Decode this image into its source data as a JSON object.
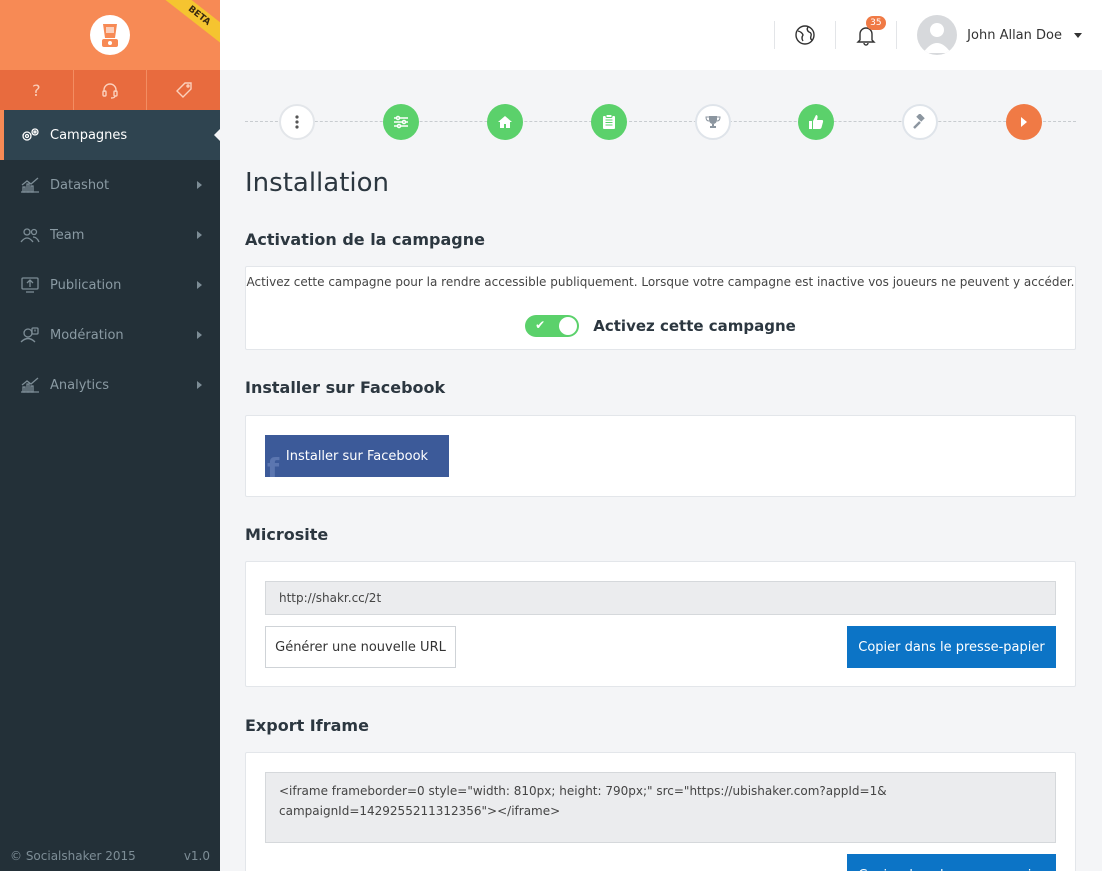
{
  "brand": {
    "beta": "BETA"
  },
  "quick_bar": {
    "help": "?"
  },
  "sidebar": {
    "items": [
      {
        "label": "Campagnes"
      },
      {
        "label": "Datashot"
      },
      {
        "label": "Team"
      },
      {
        "label": "Publication"
      },
      {
        "label": "Modération"
      },
      {
        "label": "Analytics"
      }
    ],
    "footer_copyright": "© Socialshaker 2015",
    "footer_version": "v1.0"
  },
  "topbar": {
    "notifications_count": "35",
    "user_name": "John Allan Doe"
  },
  "page": {
    "title": "Installation"
  },
  "activation": {
    "heading": "Activation de la campagne",
    "description": "Activez cette campagne pour la rendre accessible publiquement. Lorsque votre campagne est inactive vos joueurs ne peuvent y accéder.",
    "toggle_label": "Activez cette campagne"
  },
  "facebook": {
    "heading": "Installer sur Facebook",
    "button_label": "Installer sur Facebook"
  },
  "microsite": {
    "heading": "Microsite",
    "url": "http://shakr.cc/2t",
    "generate_label": "Générer une nouvelle URL",
    "copy_label": "Copier dans le presse-papier"
  },
  "iframe": {
    "heading": "Export Iframe",
    "code_line1": "<iframe frameborder=0 style=\"width: 810px; height: 790px;\" src=\"https://ubishaker.com?appId=1&",
    "code_line2": "campaignId=1429255211312356\"></iframe>",
    "copy_label": "Copier dans le presse-papier"
  },
  "colors": {
    "accent_orange": "#f78a55",
    "sidebar_bg": "#233038",
    "step_green": "#5bd16b",
    "primary_blue": "#0c74c6",
    "facebook_blue": "#3c5a99"
  }
}
